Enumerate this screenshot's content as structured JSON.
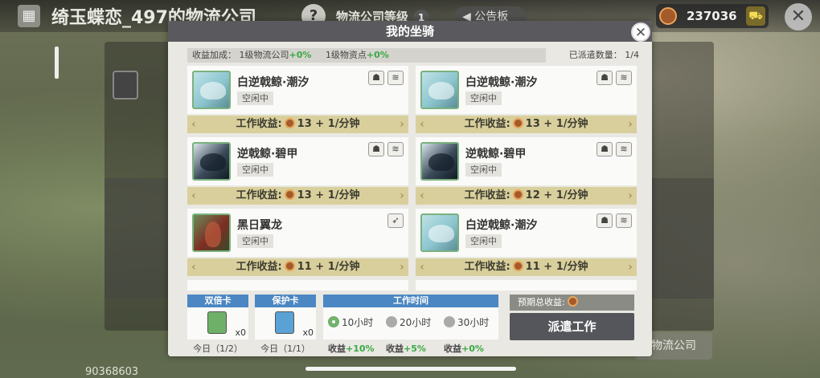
{
  "background": {
    "title": "绮玉蝶恋_497的物流公司",
    "help_glyph": "?",
    "level_label": "物流公司等级",
    "level_value": "1",
    "notice_label": "公告板",
    "coins": "237036",
    "close_glyph": "✕",
    "company_button": "物流公司",
    "player_id": "90368603"
  },
  "modal": {
    "title": "我的坐骑",
    "close_glyph": "✕",
    "bonus": {
      "label": "收益加成：",
      "company_text": "1级物流公司",
      "company_pct": "+0%",
      "outpost_text": "1级物资点",
      "outpost_pct": "+0%"
    },
    "dispatch_count": "已派遣数量：  1/4",
    "income_label": "工作收益:",
    "mounts": [
      {
        "name": "白逆戟鲸·潮汐",
        "status": "空闲中",
        "avatar": "whale",
        "traits": [
          "mask-icon",
          "wave-icon"
        ],
        "income": "13 + 1/分钟"
      },
      {
        "name": "白逆戟鲸·潮汐",
        "status": "空闲中",
        "avatar": "whale",
        "traits": [
          "mask-icon",
          "wave-icon"
        ],
        "income": "13 + 1/分钟"
      },
      {
        "name": "逆戟鲸·碧甲",
        "status": "空闲中",
        "avatar": "orca",
        "traits": [
          "mask-icon",
          "wave-icon"
        ],
        "income": "13 + 1/分钟"
      },
      {
        "name": "逆戟鲸·碧甲",
        "status": "空闲中",
        "avatar": "orca",
        "traits": [
          "mask-icon",
          "wave-icon"
        ],
        "income": "12 + 1/分钟"
      },
      {
        "name": "黑日翼龙",
        "status": "空闲中",
        "avatar": "dragon",
        "traits": [
          "wing-icon"
        ],
        "income": "11 + 1/分钟"
      },
      {
        "name": "白逆戟鲸·潮汐",
        "status": "空闲中",
        "avatar": "whale",
        "traits": [
          "mask-icon",
          "wave-icon"
        ],
        "income": "11 + 1/分钟"
      }
    ],
    "cards": [
      {
        "label": "双倍卡",
        "count": "x0",
        "today": "今日（1/2）",
        "color": "green"
      },
      {
        "label": "保护卡",
        "count": "x0",
        "today": "今日（1/1）",
        "color": "blue"
      }
    ],
    "work_time": {
      "label": "工作时间",
      "options": [
        {
          "label": "10小时",
          "selected": true,
          "bonus_label": "收益",
          "bonus": "+10%"
        },
        {
          "label": "20小时",
          "selected": false,
          "bonus_label": "收益",
          "bonus": "+5%"
        },
        {
          "label": "30小时",
          "selected": false,
          "bonus_label": "收益",
          "bonus": "+0%"
        }
      ]
    },
    "estimated_label": "预期总收益:",
    "dispatch_button": "派遣工作"
  }
}
